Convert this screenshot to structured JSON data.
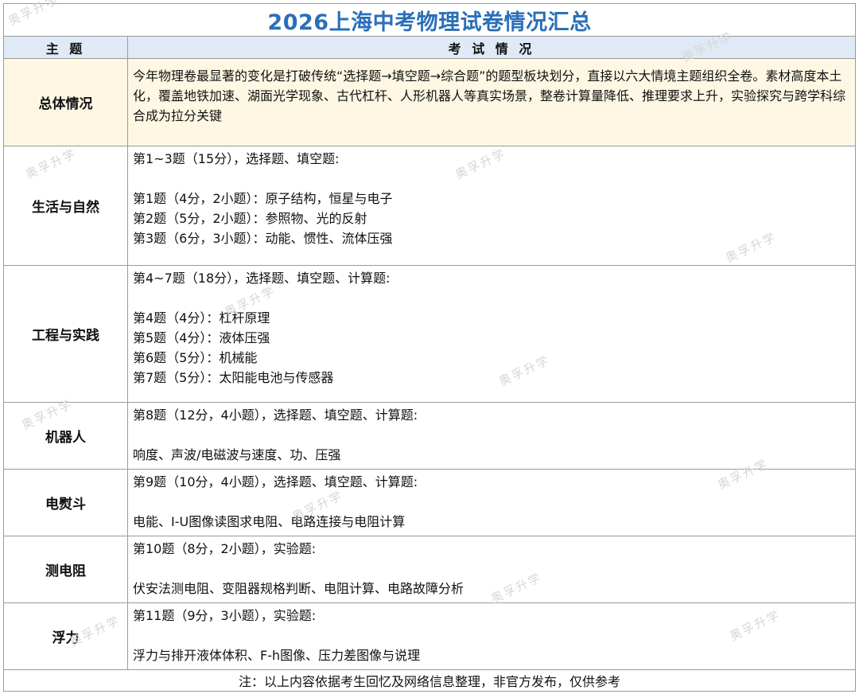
{
  "title": "2026上海中考物理试卷情况汇总",
  "title_color": "#2a6fb8",
  "header": {
    "col1": "主 题",
    "col2": "考 试 情 况"
  },
  "overview": {
    "topic": "总体情况",
    "text": "今年物理卷最显著的变化是打破传统“选择题→填空题→综合题”的题型板块划分，直接以六大情境主题组织全卷。素材高度本土化，覆盖地铁加速、湖面光学现象、古代杠杆、人形机器人等真实场景，整卷计算量降低、推理要求上升，实验探究与跨学科综合成为拉分关键"
  },
  "rows": [
    {
      "topic": "生活与自然",
      "summary": "第1~3题（15分），选择题、填空题:",
      "items": [
        "第1题（4分，2小题）：原子结构，恒星与电子",
        "第2题（5分，2小题）：参照物、光的反射",
        "第3题（6分，3小题）：动能、惯性、流体压强"
      ]
    },
    {
      "topic": "工程与实践",
      "summary": "第4~7题（18分），选择题、填空题、计算题:",
      "items": [
        "第4题（4分）：杠杆原理",
        "第5题（4分）：液体压强",
        "第6题（5分）：机械能",
        "第7题（5分）：太阳能电池与传感器"
      ]
    },
    {
      "topic": "机器人",
      "summary": "第8题（12分，4小题），选择题、填空题、计算题:",
      "items": [
        "响度、声波/电磁波与速度、功、压强"
      ]
    },
    {
      "topic": "电熨斗",
      "summary": "第9题（10分，4小题），选择题、填空题、计算题:",
      "items": [
        "电能、I-U图像读图求电阻、电路连接与电阻计算"
      ]
    },
    {
      "topic": "测电阻",
      "summary": "第10题（8分，2小题），实验题:",
      "items": [
        "伏安法测电阻、变阻器规格判断、电阻计算、电路故障分析"
      ]
    },
    {
      "topic": "浮力",
      "summary": "第11题（9分，3小题），实验题:",
      "items": [
        "浮力与排开液体体积、F-h图像、压力差图像与说理"
      ]
    }
  ],
  "footer": "注：以上内容依据考生回忆及网络信息整理，非官方发布，仅供参考",
  "watermark": "奥孚升学",
  "colors": {
    "header_bg": "#dfeaf6",
    "overview_bg": "#fdf7e3",
    "grid": "#9a9a9a"
  }
}
